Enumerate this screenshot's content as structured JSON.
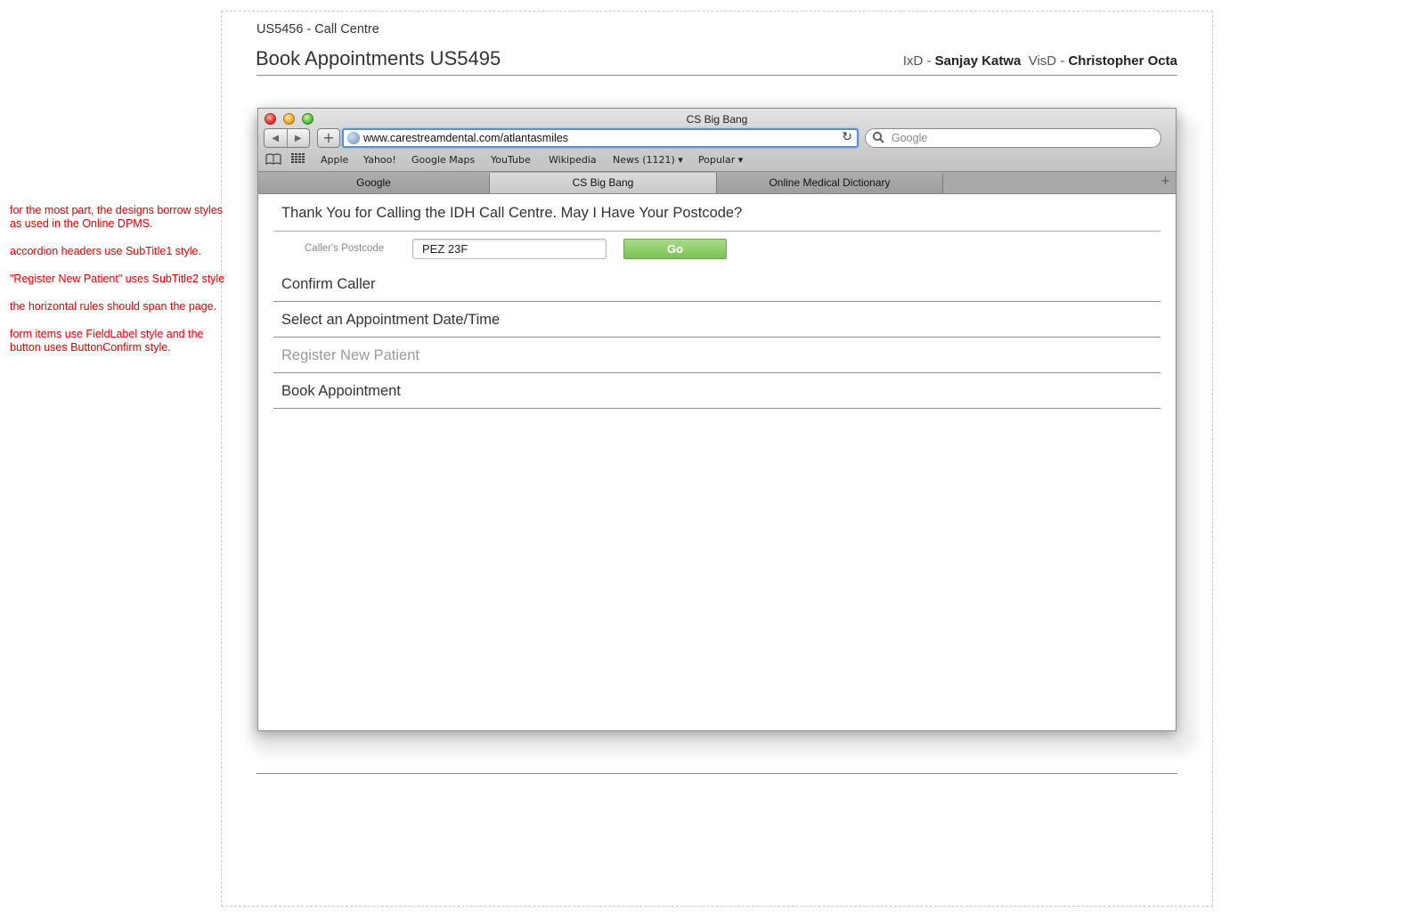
{
  "notes": [
    "for the most part, the designs borrow styles as used in the Online DPMS.",
    "accordion headers use SubTitle1 style.",
    "\"Register New Patient\" uses SubTitle2 style",
    "the horizontal rules should span the page.",
    "form items use FieldLabel style and the button uses ButtonConfirm style."
  ],
  "header": {
    "story_id": "US5456 - Call Centre",
    "title": "Book Appointments US5495",
    "ixd_label": "IxD - ",
    "ixd_name": "Sanjay Katwa",
    "visd_label": "VisD - ",
    "visd_name": "Christopher Octa"
  },
  "browser": {
    "window_title": "CS Big Bang",
    "url": "www.carestreamdental.com/atlantasmiles",
    "search_placeholder": "Google",
    "bookmarks": [
      "Apple",
      "Yahoo!",
      "Google Maps",
      "YouTube",
      "Wikipedia",
      "News (1121) ▾",
      "Popular ▾"
    ],
    "tabs": [
      "Google",
      "CS Big Bang",
      "Online Medical Dictionary"
    ],
    "active_tab": 1
  },
  "page": {
    "postcode_header": "Thank You for Calling the IDH Call Centre. May I Have Your Postcode?",
    "postcode_label": "Caller's Postcode",
    "postcode_value": "PEZ 23F",
    "go_label": "Go",
    "sections": [
      "Confirm Caller",
      "Select an Appointment Date/Time",
      "Register New Patient",
      "Book Appointment"
    ]
  },
  "icons": {
    "reload": "↻",
    "search": "🔍",
    "bookmarks_book": "📖",
    "top_sites": "▦",
    "back": "◀",
    "forward": "▶",
    "add": "+",
    "new_tab": "+"
  },
  "colors": {
    "note_red": "#e00000",
    "go_green": "#7dc157",
    "address_focus": "#5a8fd2"
  }
}
